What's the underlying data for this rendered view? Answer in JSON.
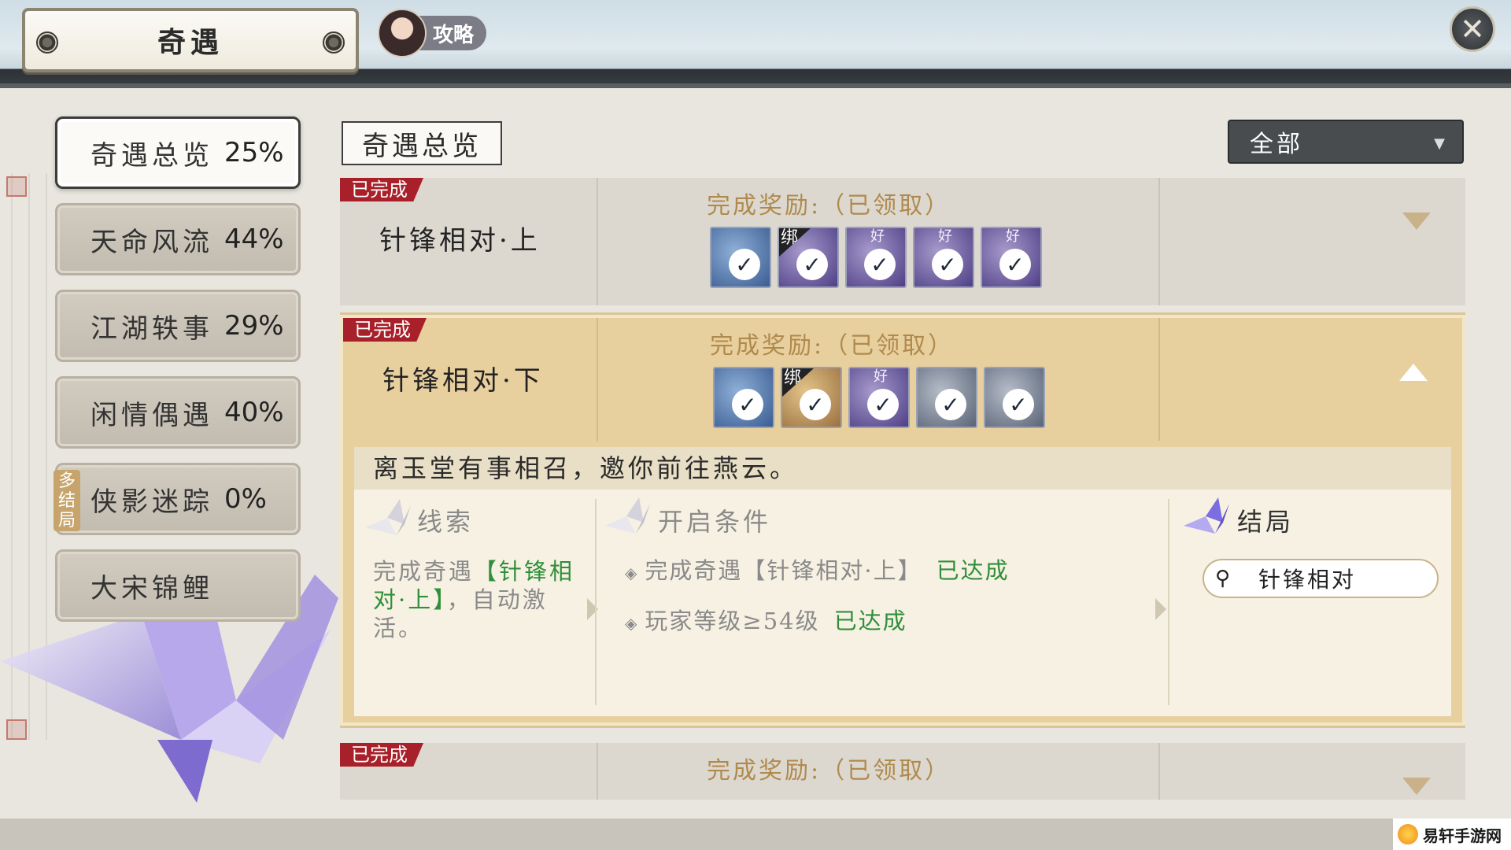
{
  "header": {
    "title": "奇遇",
    "guide_label": "攻略",
    "close_icon": "close-icon"
  },
  "sidebar": {
    "items": [
      {
        "name": "奇遇总览",
        "pct": "25%",
        "active": true
      },
      {
        "name": "天命风流",
        "pct": "44%"
      },
      {
        "name": "江湖轶事",
        "pct": "29%"
      },
      {
        "name": "闲情偶遇",
        "pct": "40%"
      },
      {
        "name": "侠影迷踪",
        "pct": "0%",
        "tag": "多结局"
      },
      {
        "name": "大宋锦鲤",
        "pct": ""
      }
    ]
  },
  "main": {
    "section_tab": "奇遇总览",
    "filter_value": "全部",
    "quests": [
      {
        "status": "已完成",
        "name": "针锋相对·上",
        "reward_title": "完成奖励:（已领取）",
        "rewards": [
          {
            "style": "blue",
            "tag": ""
          },
          {
            "style": "purple",
            "tag": "绑"
          },
          {
            "style": "purple",
            "tag": "好"
          },
          {
            "style": "purple",
            "tag": "好"
          },
          {
            "style": "purple",
            "tag": "好"
          }
        ]
      },
      {
        "status": "已完成",
        "name": "针锋相对·下",
        "reward_title": "完成奖励:（已领取）",
        "rewards": [
          {
            "style": "blue",
            "tag": ""
          },
          {
            "style": "gold",
            "tag": "绑"
          },
          {
            "style": "purple",
            "tag": "好"
          },
          {
            "style": "steel",
            "tag": ""
          },
          {
            "style": "steel",
            "tag": ""
          }
        ],
        "description": "离玉堂有事相召，邀你前往燕云。",
        "clue": {
          "heading": "线索",
          "text_before": "完成奇遇",
          "highlight": "【针锋相对·上】",
          "text_after": "，自动激活。"
        },
        "conditions": {
          "heading": "开启条件",
          "items": [
            {
              "text": "完成奇遇【针锋相对·上】",
              "status": "已达成"
            },
            {
              "text": "玩家等级≥54级",
              "status": "已达成"
            }
          ]
        },
        "ending": {
          "heading": "结局",
          "button_label": "针锋相对"
        }
      },
      {
        "status": "已完成",
        "name": "",
        "reward_title": "完成奖励:（已领取）"
      }
    ]
  },
  "watermark": "易轩手游网",
  "colors": {
    "completed_tag": "#a8202a",
    "achieved_green": "#2f8f3a",
    "reward_gold_text": "#b08a4c",
    "open_card": "#e8cf9e"
  }
}
